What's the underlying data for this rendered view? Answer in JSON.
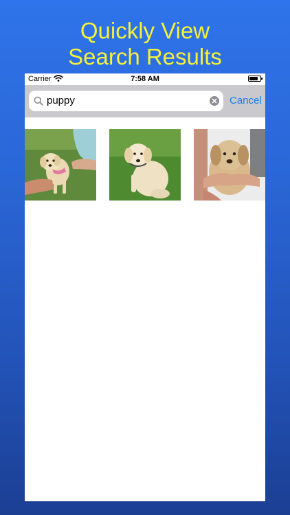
{
  "headline": {
    "line1": "Quickly View",
    "line2": "Search Results"
  },
  "status_bar": {
    "carrier": "Carrier",
    "time": "7:58 AM"
  },
  "search": {
    "query": "puppy",
    "cancel_label": "Cancel"
  },
  "results": [
    {
      "subject": "puppy-photo"
    },
    {
      "subject": "puppy-photo"
    },
    {
      "subject": "puppy-photo"
    }
  ],
  "colors": {
    "headline": "#f5f03a",
    "accent": "#1a7cf5",
    "search_bar_bg": "#c9c9ce",
    "background_top": "#2f74ea",
    "background_bottom": "#1b3f93"
  },
  "icons": [
    "wifi-icon",
    "battery-icon",
    "search-icon",
    "clear-icon"
  ]
}
